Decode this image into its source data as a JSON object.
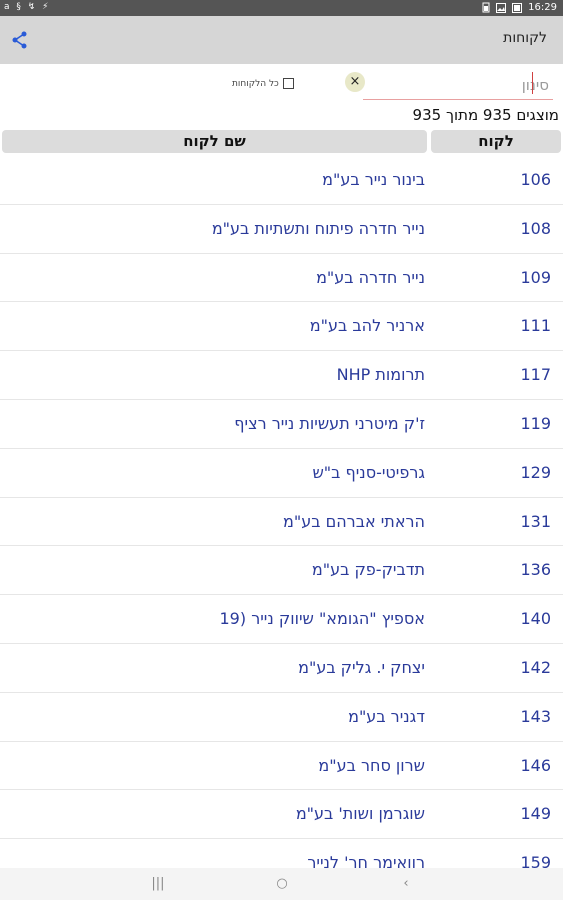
{
  "status_bar": {
    "left_icons": "a § ↯ ⚡",
    "time": "16:29"
  },
  "app_bar": {
    "title": "לקוחות",
    "share_icon": "share-icon"
  },
  "filter": {
    "placeholder": "סינון",
    "value": "",
    "clear_label": "×",
    "all_customers_label": "כל הלקוחות"
  },
  "count_text": "מוצגים 935 מתוך 935",
  "table": {
    "headers": {
      "code": "לקוח",
      "name": "שם לקוח"
    },
    "rows": [
      {
        "code": "106",
        "name": "בינור נייר בע\"מ"
      },
      {
        "code": "108",
        "name": "נייר חדרה פיתוח ותשתיות בע\"מ"
      },
      {
        "code": "109",
        "name": "נייר חדרה בע\"מ"
      },
      {
        "code": "111",
        "name": "ארניר להב בע\"מ"
      },
      {
        "code": "117",
        "name": "תרומות NHP"
      },
      {
        "code": "119",
        "name": "ז'ק מיטרני תעשיות נייר רציף"
      },
      {
        "code": "129",
        "name": "גרפיטי-סניף ב\"ש"
      },
      {
        "code": "131",
        "name": "הראתי אברהם בע\"מ"
      },
      {
        "code": "136",
        "name": "תדביק-פק בע\"מ"
      },
      {
        "code": "140",
        "name": "אספיץ \"הגומא\" שיווק נייר (19"
      },
      {
        "code": "142",
        "name": "יצחק י. גליק בע\"מ"
      },
      {
        "code": "143",
        "name": "דגניר בע\"מ"
      },
      {
        "code": "146",
        "name": "שרון סחר בע\"מ"
      },
      {
        "code": "149",
        "name": "שוגרמן ושות' בע\"מ"
      },
      {
        "code": "159",
        "name": "רוואימר חר' לנייר"
      }
    ]
  },
  "nav_bar": {
    "recents": "|||",
    "home": "○",
    "back": "‹"
  }
}
